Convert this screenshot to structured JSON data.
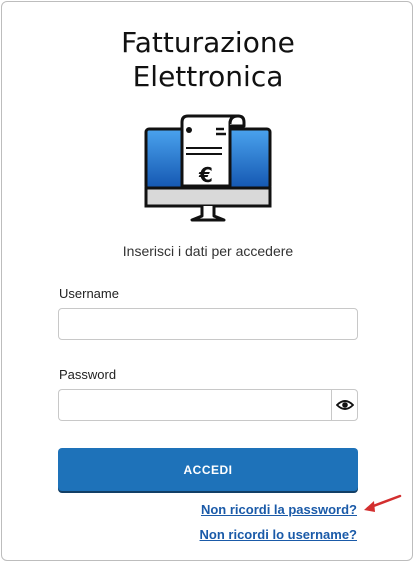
{
  "header": {
    "title_line1": "Fatturazione",
    "title_line2": "Elettronica"
  },
  "illustration": {
    "icon": "computer-invoice-euro-icon",
    "currency_symbol": "€"
  },
  "subtitle": "Inserisci i dati per accedere",
  "form": {
    "username_label": "Username",
    "username_value": "",
    "password_label": "Password",
    "password_value": "",
    "show_password_icon": "eye-icon",
    "submit_label": "ACCEDI"
  },
  "links": {
    "forgot_password": "Non ricordi la password?",
    "forgot_username": "Non ricordi lo username?"
  },
  "colors": {
    "primary": "#1e72b9",
    "link": "#1a5aa8",
    "annotation_arrow": "#d32f2f"
  }
}
